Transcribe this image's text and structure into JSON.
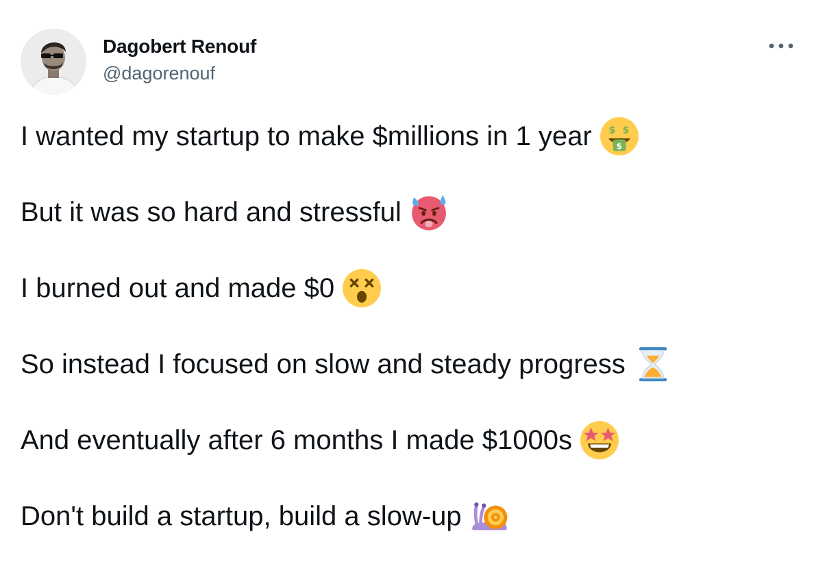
{
  "author": {
    "name": "Dagobert Renouf",
    "handle": "@dagorenouf"
  },
  "more_button": {
    "label": "···"
  },
  "tweet": {
    "lines": [
      {
        "text": "I wanted my startup to make $millions in 1 year",
        "emoji": "money-mouth-face-icon"
      },
      {
        "text": "But it was so hard and stressful",
        "emoji": "hot-face-sweat-icon"
      },
      {
        "text": "I burned out and made $0",
        "emoji": "dizzy-face-icon"
      },
      {
        "text": "So instead I focused on slow and steady progress",
        "emoji": "hourglass-icon"
      },
      {
        "text": "And eventually after 6 months I made $1000s",
        "emoji": "star-struck-icon"
      },
      {
        "text": "Don't build a startup, build a slow-up",
        "emoji": "snail-icon"
      }
    ]
  },
  "colors": {
    "text": "#0f1419",
    "handle": "#536471",
    "emoji_yellow": "#FFCC4D",
    "emoji_red": "#E75A70",
    "emoji_blue": "#5DADEC",
    "emoji_green": "#77B255"
  }
}
